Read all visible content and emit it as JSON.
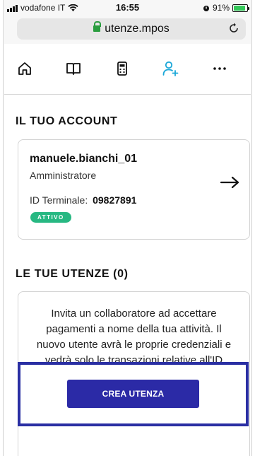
{
  "status_bar": {
    "carrier": "vodafone IT",
    "time": "16:55",
    "battery": "91%"
  },
  "browser": {
    "url": "utenze.mpos"
  },
  "nav": {
    "items": [
      "home-icon",
      "book-icon",
      "calculator-icon",
      "add-user-icon",
      "more-icon"
    ],
    "active": "add-user-icon",
    "accent_color": "#1aa7d8"
  },
  "account": {
    "section_title": "IL TUO ACCOUNT",
    "username": "manuele.bianchi_01",
    "role": "Amministratore",
    "terminal_label": "ID Terminale:",
    "terminal_id": "09827891",
    "status_badge": "ATTIVO"
  },
  "users": {
    "section_title": "LE TUE UTENZE (0)",
    "invite_text": "Invita un collaboratore ad accettare pagamenti a nome della tua attività. Il nuovo utente avrà le proprie credenziali e vedrà solo le transazioni relative all'ID Terminale a lui assegnato",
    "create_button": "CREA UTENZA"
  },
  "colors": {
    "badge": "#27b882",
    "button": "#2b2aa6",
    "highlight_border": "#2a2fa3"
  }
}
